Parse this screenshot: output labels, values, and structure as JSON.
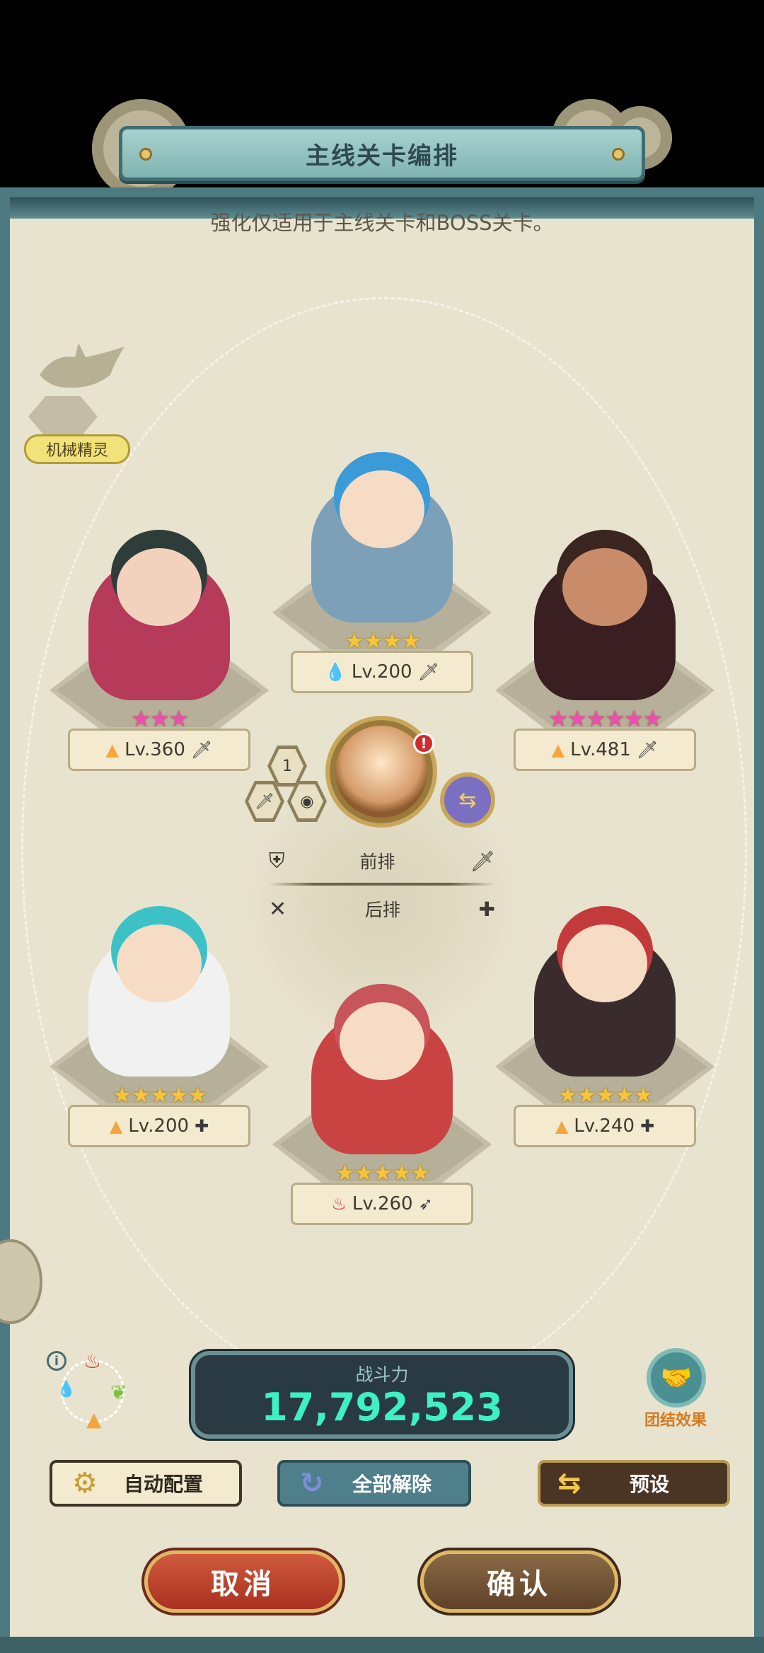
{
  "header": {
    "title": "主线关卡编排",
    "subtitle": "强化仅适用于主线关卡和BOSS关卡。"
  },
  "spirit": {
    "label": "机械精灵"
  },
  "heroes": [
    {
      "slot": "front-left",
      "stars": "★★★",
      "star_color": "#ec4fb0",
      "element_icon": "fire-icon",
      "element_glyph": "▲",
      "element_color": "#f3a640",
      "level": "Lv.360",
      "role_icon": "sword-icon",
      "role_glyph": "🗡",
      "body_color": "#b63a5a",
      "head_color": "#f3d2bd",
      "hair_color": "#2f3d3a"
    },
    {
      "slot": "front-center",
      "stars": "★★★★",
      "star_color": "#f6c43a",
      "element_icon": "water-icon",
      "element_glyph": "💧",
      "element_color": "#4d8fdc",
      "level": "Lv.200",
      "role_icon": "sword-icon",
      "role_glyph": "🗡",
      "body_color": "#7ba0b8",
      "head_color": "#f6dcc5",
      "hair_color": "#3b9ad8"
    },
    {
      "slot": "front-right",
      "stars": "★★★★★★",
      "star_color": "#ec4fb0",
      "element_icon": "fire-icon",
      "element_glyph": "▲",
      "element_color": "#f3a640",
      "level": "Lv.481",
      "role_icon": "sword-icon",
      "role_glyph": "🗡",
      "body_color": "#3a1f22",
      "head_color": "#c98c6a",
      "hair_color": "#3a2520"
    },
    {
      "slot": "back-left",
      "stars": "★★★★★",
      "star_color": "#f6c43a",
      "element_icon": "fire-icon",
      "element_glyph": "▲",
      "element_color": "#f3a640",
      "level": "Lv.200",
      "role_icon": "plus-icon",
      "role_glyph": "✚",
      "body_color": "#f1f1f1",
      "head_color": "#f6dcc5",
      "hair_color": "#3cc2c6"
    },
    {
      "slot": "back-center",
      "stars": "★★★★★",
      "star_color": "#f6c43a",
      "element_icon": "flame-icon",
      "element_glyph": "♨",
      "element_color": "#d8342b",
      "level": "Lv.260",
      "role_icon": "bow-icon",
      "role_glyph": "➶",
      "body_color": "#c94343",
      "head_color": "#f6dcc5",
      "hair_color": "#c7555a"
    },
    {
      "slot": "back-right",
      "stars": "★★★★★",
      "star_color": "#f6c43a",
      "element_icon": "fire-icon",
      "element_glyph": "▲",
      "element_color": "#f3a640",
      "level": "Lv.240",
      "role_icon": "plus-icon",
      "role_glyph": "✚",
      "body_color": "#3a2c2c",
      "head_color": "#f6dcc5",
      "hair_color": "#c33a3a"
    }
  ],
  "leader": {
    "rank": "1",
    "badge": "!",
    "skill_glyph_1": "🗡",
    "skill_glyph_2": "◉",
    "swap_glyph": "⇆"
  },
  "rows": {
    "front": {
      "icon_glyph": "⛨",
      "label": "前排",
      "role_glyph": "🗡"
    },
    "back": {
      "icon_glyph": "✕",
      "label": "后排",
      "role_glyph": "✚"
    }
  },
  "power": {
    "label": "战斗力",
    "value": "17,792,523"
  },
  "synergy": {
    "label": "团结效果",
    "glyph": "🤝"
  },
  "buttons": {
    "auto": "自动配置",
    "auto_glyph": "⚙",
    "clear": "全部解除",
    "clear_glyph": "↻",
    "preset": "预设",
    "preset_glyph": "⇆",
    "cancel": "取消",
    "confirm": "确认"
  },
  "elements_wheel": {
    "info_glyph": "i",
    "items": [
      {
        "name": "flame",
        "glyph": "♨",
        "color": "#d8342b"
      },
      {
        "name": "wind",
        "glyph": "❦",
        "color": "#7fbf3a"
      },
      {
        "name": "earth",
        "glyph": "▲",
        "color": "#f3a640"
      },
      {
        "name": "water",
        "glyph": "💧",
        "color": "#4d8fdc"
      }
    ]
  }
}
